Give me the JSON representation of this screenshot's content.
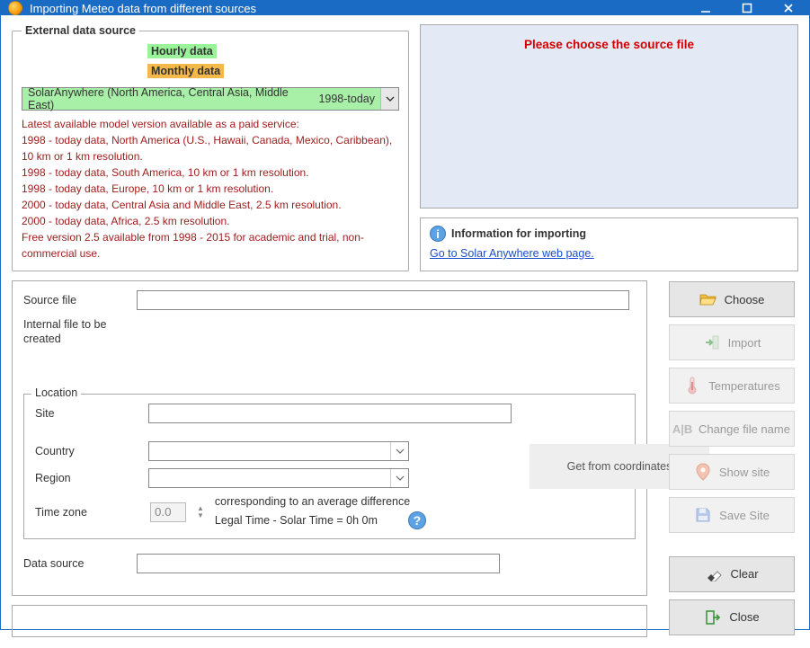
{
  "window": {
    "title": "Importing Meteo data from different sources"
  },
  "external_source": {
    "legend": "External data source",
    "hourly_label": "Hourly data",
    "monthly_label": "Monthly data",
    "combo": {
      "name": "SolarAnywhere (North America, Central Asia, Middle East)",
      "range": "1998-today"
    },
    "description_lines": [
      "Latest available model version available as a paid service:",
      "1998 - today data, North America (U.S., Hawaii, Canada, Mexico, Caribbean), 10 km or 1 km resolution.",
      "1998 - today data, South America, 10 km or 1 km resolution.",
      "1998 - today data, Europe, 10 km or 1 km resolution.",
      "2000 - today data, Central Asia and Middle East, 2.5 km resolution.",
      "2000 - today data, Africa, 2.5 km resolution.",
      "Free version 2.5 available from 1998 - 2015 for academic and trial, non-commercial use."
    ]
  },
  "message_box": {
    "text": "Please choose the source file"
  },
  "info_box": {
    "title": "Information for importing",
    "link_text": "Go to Solar Anywhere web page."
  },
  "mid": {
    "source_file_label": "Source file",
    "source_file_value": "",
    "internal_file_label": "Internal file to be created",
    "data_source_label": "Data source",
    "data_source_value": ""
  },
  "location": {
    "legend": "Location",
    "site_label": "Site",
    "site_value": "",
    "country_label": "Country",
    "country_value": "",
    "region_label": "Region",
    "region_value": "",
    "timezone_label": "Time zone",
    "timezone_value": "0.0",
    "tz_note": "corresponding to an average difference",
    "tz_equation": "Legal Time - Solar Time =   0h  0m",
    "coord_btn": "Get from coordinates"
  },
  "right_buttons": {
    "choose": "Choose",
    "import": "Import",
    "temperatures": "Temperatures",
    "change_name": "Change file name",
    "show_site": "Show site",
    "save_site": "Save Site",
    "clear": "Clear",
    "close": "Close"
  }
}
